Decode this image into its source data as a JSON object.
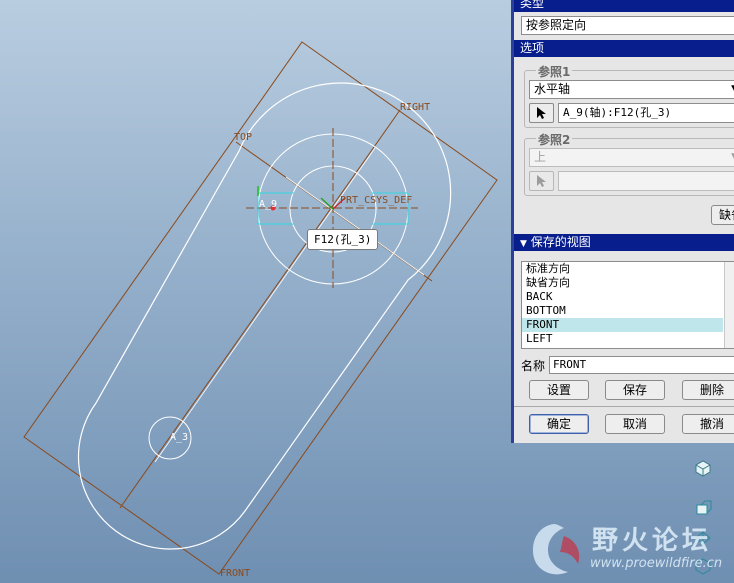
{
  "viewport": {
    "datums": {
      "top": "TOP",
      "right": "RIGHT",
      "front": "FRONT",
      "csys": "PRT_CSYS_DEF"
    },
    "axis_labels": {
      "a9": "A_9",
      "a3": "A_3"
    },
    "callout": "F12(孔_3)"
  },
  "dialog": {
    "type_section": "类型",
    "type_value": "按参照定向",
    "options_section": "选项",
    "ref1": {
      "title": "参照1",
      "value": "水平轴",
      "selection": "A_9(轴):F12(孔_3)"
    },
    "ref2": {
      "title": "参照2",
      "value": "上",
      "selection": ""
    },
    "default_button": "缺省",
    "saved_views_section": "保存的视图",
    "saved_views": [
      "标准方向",
      "缺省方向",
      "BACK",
      "BOTTOM",
      "FRONT",
      "LEFT"
    ],
    "selected_view": "FRONT",
    "name_label": "名称",
    "name_value": "FRONT",
    "buttons": {
      "set": "设置",
      "save": "保存",
      "delete": "删除"
    },
    "footer": {
      "ok": "确定",
      "cancel": "取消",
      "undo": "撤消"
    }
  },
  "watermark": {
    "name": "野火论坛",
    "url": "www.proewildfire.cn"
  }
}
